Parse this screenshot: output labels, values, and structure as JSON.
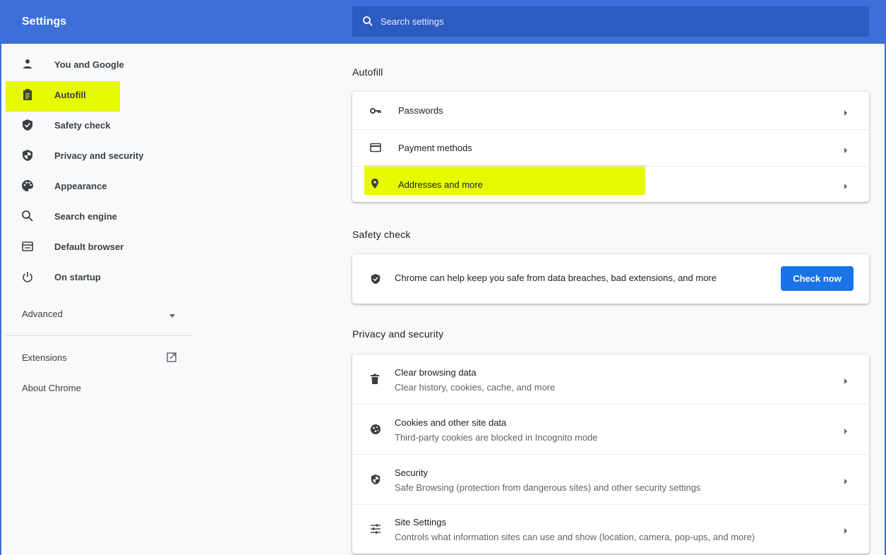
{
  "header": {
    "title": "Settings",
    "search_placeholder": "Search settings"
  },
  "sidebar": {
    "items": [
      {
        "label": "You and Google",
        "icon": "person-icon"
      },
      {
        "label": "Autofill",
        "icon": "clipboard-icon"
      },
      {
        "label": "Safety check",
        "icon": "shield-check-icon"
      },
      {
        "label": "Privacy and security",
        "icon": "shield-half-icon"
      },
      {
        "label": "Appearance",
        "icon": "palette-icon"
      },
      {
        "label": "Search engine",
        "icon": "search-icon"
      },
      {
        "label": "Default browser",
        "icon": "browser-window-icon"
      },
      {
        "label": "On startup",
        "icon": "power-icon"
      }
    ],
    "advanced_label": "Advanced",
    "extensions_label": "Extensions",
    "about_label": "About Chrome",
    "highlight_color": "#e6fa00"
  },
  "autofill": {
    "title": "Autofill",
    "rows": [
      {
        "label": "Passwords",
        "icon": "key-icon"
      },
      {
        "label": "Payment methods",
        "icon": "credit-card-icon"
      },
      {
        "label": "Addresses and more",
        "icon": "location-pin-icon"
      }
    ]
  },
  "safety": {
    "title": "Safety check",
    "text": "Chrome can help keep you safe from data breaches, bad extensions, and more",
    "button_label": "Check now"
  },
  "privacy": {
    "title": "Privacy and security",
    "rows": [
      {
        "title": "Clear browsing data",
        "subtitle": "Clear history, cookies, cache, and more",
        "icon": "trash-icon"
      },
      {
        "title": "Cookies and other site data",
        "subtitle": "Third-party cookies are blocked in Incognito mode",
        "icon": "cookie-icon"
      },
      {
        "title": "Security",
        "subtitle": "Safe Browsing (protection from dangerous sites) and other security settings",
        "icon": "shield-half-icon"
      },
      {
        "title": "Site Settings",
        "subtitle": "Controls what information sites can use and show (location, camera, pop-ups, and more)",
        "icon": "sliders-icon"
      }
    ]
  },
  "colors": {
    "header": "#3c6fd8",
    "search_bg": "#2c5bc1",
    "accent_button": "#1a73e8",
    "highlight": "#e6fa00"
  }
}
